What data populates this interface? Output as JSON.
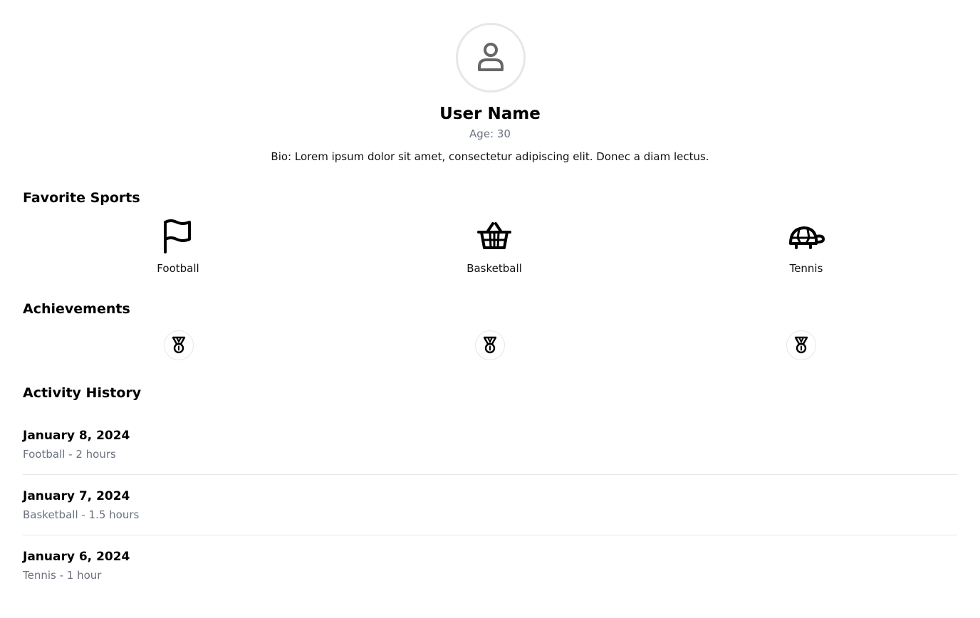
{
  "profile": {
    "avatar_icon": "user-icon",
    "name": "User Name",
    "age": "Age: 30",
    "bio": "Bio: Lorem ipsum dolor sit amet, consectetur adipiscing elit. Donec a diam lectus."
  },
  "sections": {
    "favorite_sports": "Favorite Sports",
    "achievements": "Achievements",
    "activity_history": "Activity History"
  },
  "sports": [
    {
      "label": "Football",
      "icon": "flag-icon"
    },
    {
      "label": "Basketball",
      "icon": "basket-icon"
    },
    {
      "label": "Tennis",
      "icon": "turtle-icon"
    }
  ],
  "achievements": [
    {
      "icon": "medal-icon"
    },
    {
      "icon": "medal-icon"
    },
    {
      "icon": "medal-icon"
    }
  ],
  "activities": [
    {
      "date": "January 8, 2024",
      "detail": "Football - 2 hours"
    },
    {
      "date": "January 7, 2024",
      "detail": "Basketball - 1.5 hours"
    },
    {
      "date": "January 6, 2024",
      "detail": "Tennis - 1 hour"
    }
  ],
  "colors": {
    "muted_text": "#6b7280",
    "border": "#e5e7eb",
    "icon_gray": "#666666"
  }
}
